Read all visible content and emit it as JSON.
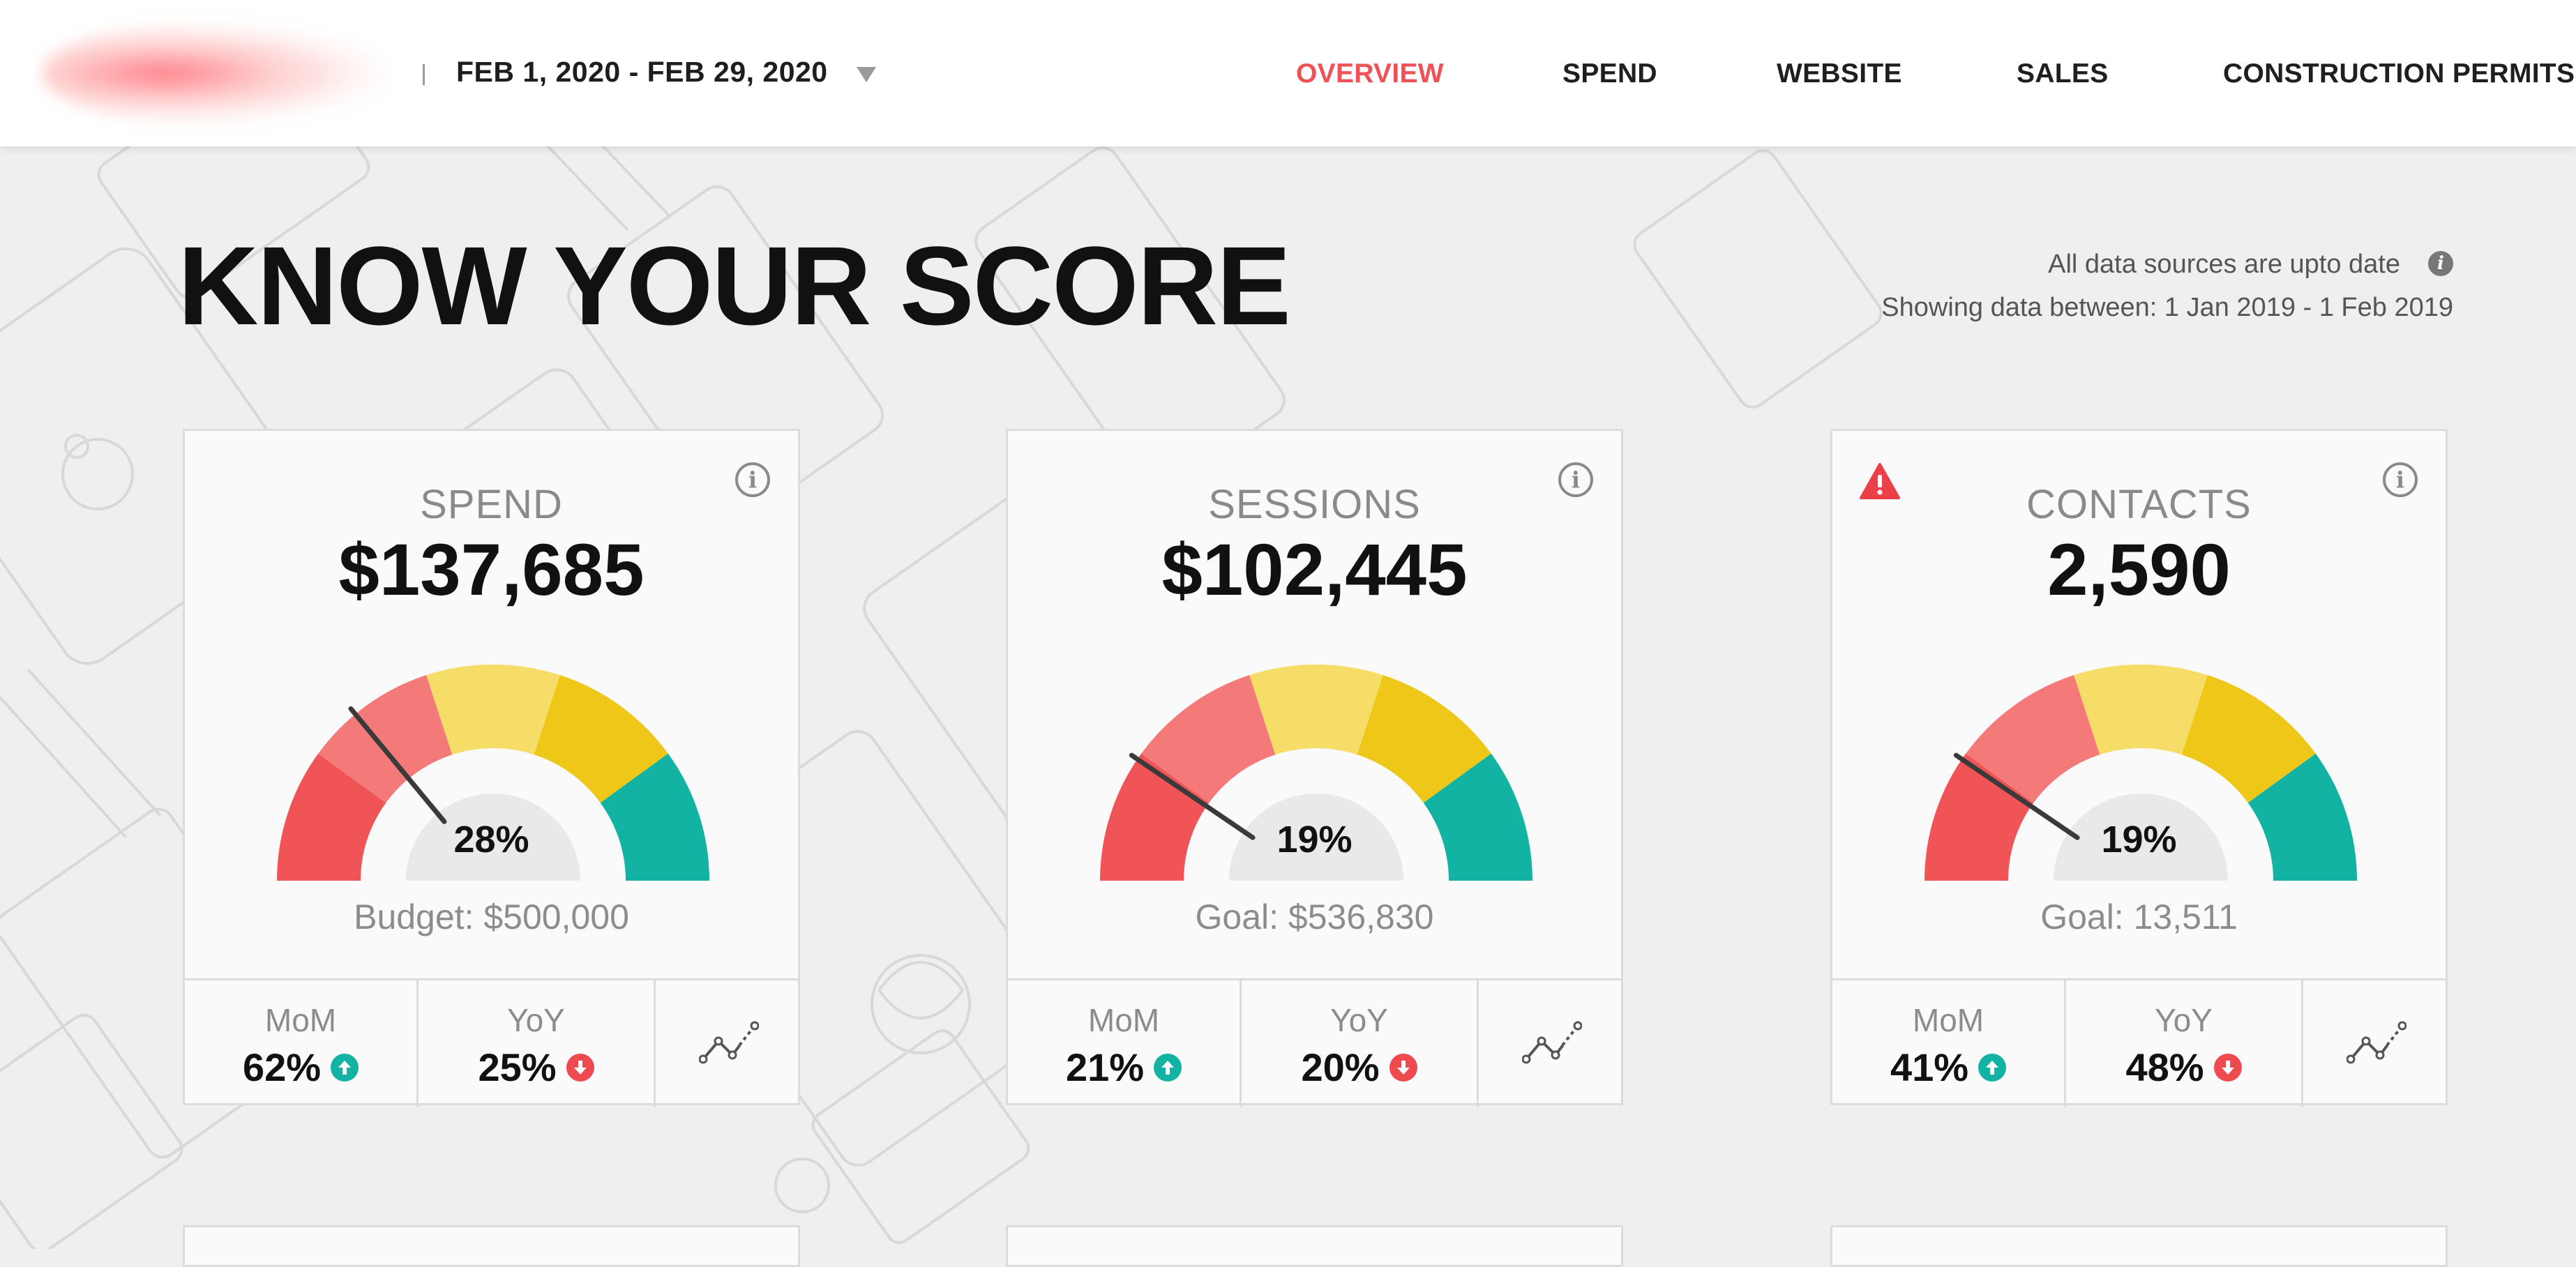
{
  "header": {
    "date_range": "FEB 1, 2020 - FEB 29, 2020",
    "nav": [
      {
        "label": "OVERVIEW",
        "active": true
      },
      {
        "label": "SPEND",
        "active": false
      },
      {
        "label": "WEBSITE",
        "active": false
      },
      {
        "label": "SALES",
        "active": false
      },
      {
        "label": "CONSTRUCTION PERMITS",
        "active": false
      }
    ]
  },
  "page": {
    "title": "KNOW YOUR SCORE",
    "status": "All data sources are upto date",
    "showing": "Showing data between: 1 Jan 2019 - 1 Feb 2019",
    "info_icon": "i"
  },
  "cards": [
    {
      "label": "SPEND",
      "value": "$137,685",
      "gauge_percent": "28%",
      "gauge_level": 0.28,
      "target": "Budget: $500,000",
      "warning": false,
      "mom_label": "MoM",
      "mom_value": "62%",
      "mom_direction": "up",
      "yoy_label": "YoY",
      "yoy_value": "25%",
      "yoy_direction": "down"
    },
    {
      "label": "SESSIONS",
      "value": "$102,445",
      "gauge_percent": "19%",
      "gauge_level": 0.19,
      "target": "Goal: $536,830",
      "warning": false,
      "mom_label": "MoM",
      "mom_value": "21%",
      "mom_direction": "up",
      "yoy_label": "YoY",
      "yoy_value": "20%",
      "yoy_direction": "down"
    },
    {
      "label": "CONTACTS",
      "value": "2,590",
      "gauge_percent": "19%",
      "gauge_level": 0.19,
      "target": "Goal: 13,511",
      "warning": true,
      "mom_label": "MoM",
      "mom_value": "41%",
      "mom_direction": "up",
      "yoy_label": "YoY",
      "yoy_value": "48%",
      "yoy_direction": "down"
    }
  ],
  "colors": {
    "accent": "#ef5256",
    "gauge_segments": [
      "#f05457",
      "#f47a7a",
      "#f6dd68",
      "#efc718",
      "#12b3a2"
    ],
    "up": "#12b3a2",
    "down": "#ef4a50",
    "warning": "#ec4048"
  },
  "icons": {
    "info": "info-circle-icon",
    "warning": "warning-triangle-icon",
    "trend": "trend-line-icon",
    "arrow_up": "arrow-up-circle-icon",
    "arrow_down": "arrow-down-circle-icon",
    "caret": "caret-down-icon"
  }
}
